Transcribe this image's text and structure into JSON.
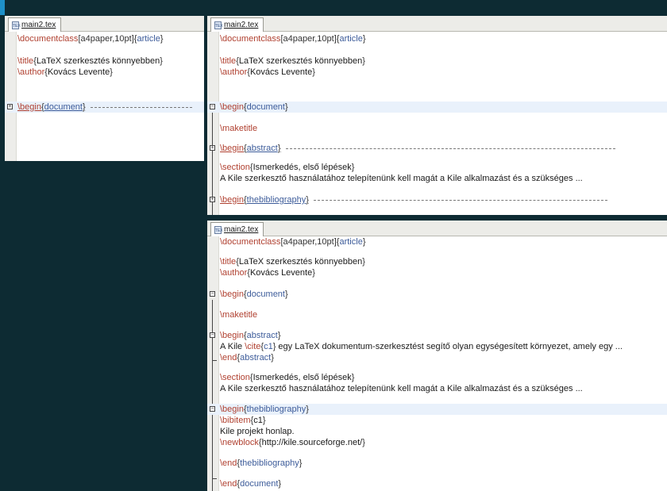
{
  "tab_title": "main2.tex",
  "file_icon": "tex-file-icon",
  "colors": {
    "command": "#b04030",
    "argument": "#3d5c9a",
    "highlight": "#e9f1fb",
    "background": "#0d2b33"
  },
  "code": {
    "documentclass_cmd": "\\documentclass",
    "documentclass_opt": "[a4paper,10pt]",
    "documentclass_arg": "article",
    "title_cmd": "\\title",
    "title_arg": "LaTeX szerkesztés könnyebben",
    "author_cmd": "\\author",
    "author_arg": "Kovács Levente",
    "begin_cmd": "\\begin",
    "end_cmd": "\\end",
    "document_env": "document",
    "abstract_env": "abstract",
    "bibliography_env": "thebibliography",
    "maketitle_cmd": "\\maketitle",
    "section_cmd": "\\section",
    "section_arg": "Ismerkedés, első lépések",
    "section_text": "A Kile szerkesztő használatához telepítenünk kell magát a Kile alkalmazást és a szükséges ...",
    "abstract_pre": "A Kile ",
    "cite_cmd": "\\cite",
    "cite_arg": "c1",
    "abstract_post": " egy LaTeX dokumentum-szerkesztést segítő olyan egységesített környezet, amely egy ...",
    "bibitem_cmd": "\\bibitem",
    "bibitem_arg": "c1",
    "bib_text": "Kile projekt honlap.",
    "newblock_cmd": "\\newblock",
    "newblock_arg": "http://kile.sourceforge.net/"
  }
}
